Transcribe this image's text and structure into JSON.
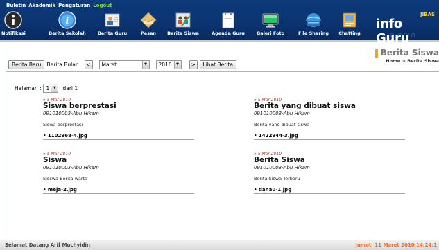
{
  "topmenu": [
    "Buletin",
    "Akademik",
    "Pengaturan",
    "Logout"
  ],
  "nav": [
    {
      "label": "Notifikasi",
      "icon": "info-icon"
    },
    {
      "label": "Berita Sekolah",
      "icon": "info-globe-icon"
    },
    {
      "label": "Berita Guru",
      "icon": "teacher-news-icon"
    },
    {
      "label": "Pesan",
      "icon": "envelope-icon"
    },
    {
      "label": "Berita Siswa",
      "icon": "student-news-icon"
    },
    {
      "label": "Agenda Guru",
      "icon": "notebook-icon"
    },
    {
      "label": "Galeri Foto",
      "icon": "monitor-icon"
    },
    {
      "label": "File Sharing",
      "icon": "file-sharing-icon"
    },
    {
      "label": "Chatting",
      "icon": "chat-icon"
    }
  ],
  "logo": {
    "jibas": "JIBAS",
    "name": "info Guru"
  },
  "toolbar": {
    "new_button": "Berita Baru",
    "month_label": "Berita Bulan :",
    "prev": "<",
    "month": "Maret",
    "year": "2010",
    "next": ">",
    "view_button": "Lihat Berita"
  },
  "section": {
    "title": "Berita Siswa",
    "crumb_home": "Home",
    "crumb_sep": ">",
    "crumb_current": "Berita Siswa"
  },
  "paging": {
    "label": "Halaman :",
    "page": "1",
    "of": "dari 1"
  },
  "news": [
    {
      "date": "5 Mar 2010",
      "title": "Siswa berprestasi",
      "author": "091010003-Abu Hikam",
      "body": "Siswa berprestasi",
      "file": "1102968-4.jpg"
    },
    {
      "date": "5 Mar 2010",
      "title": "Berita yang dibuat siswa",
      "author": "091010003-Abu Hikam",
      "body": "Berita yang dibuat siswa",
      "file": "1422944-3.jpg"
    },
    {
      "date": "5 Mar 2010",
      "title": "Siswa",
      "author": "091010003-Abu Hikam",
      "body": "Sisswa Berita warta",
      "file": "meja-2.jpg"
    },
    {
      "date": "5 Mar 2010",
      "title": "Berita Siswa",
      "author": "091010003-Abu Hikam",
      "body": "Berita Siswa Terbaru",
      "file": "danau-1.jpg"
    }
  ],
  "status": {
    "welcome": "Selamat Datang Arif Muchyidin",
    "datetime": "Jumat, 11 Maret 2010 14:24:1"
  },
  "colors": {
    "header": "#0b3370",
    "logout": "#7be11a",
    "accent": "#f2a12e",
    "status_time": "#f06a26",
    "date": "#d02626"
  }
}
